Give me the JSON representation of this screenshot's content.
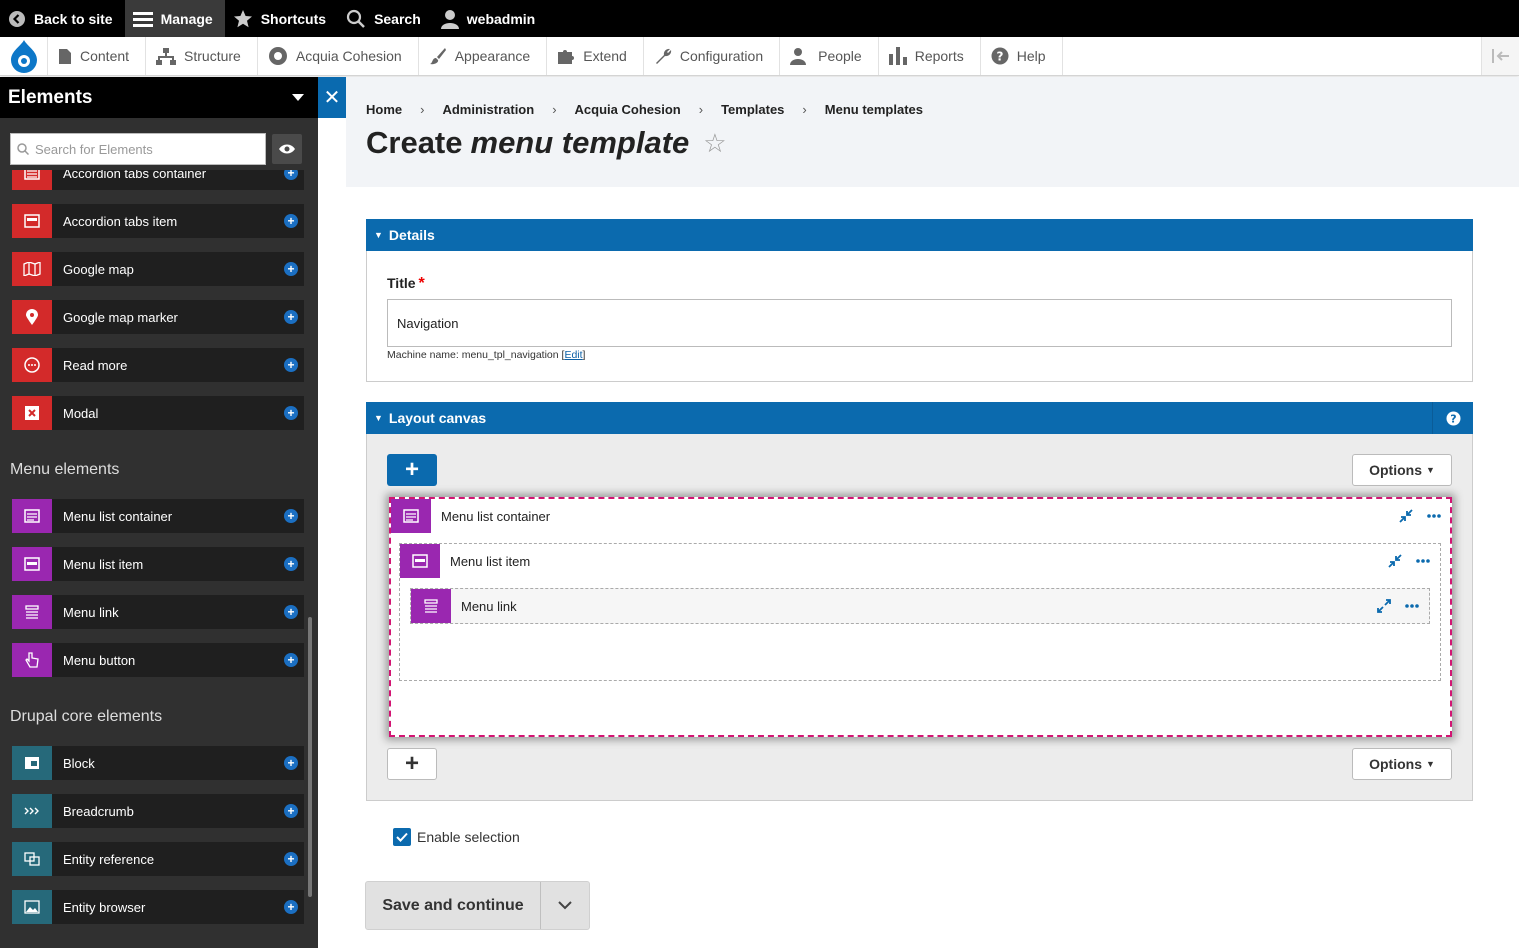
{
  "topbar": {
    "back": "Back to site",
    "manage": "Manage",
    "shortcuts": "Shortcuts",
    "search": "Search",
    "user": "webadmin"
  },
  "tray": {
    "items": [
      "Content",
      "Structure",
      "Acquia Cohesion",
      "Appearance",
      "Extend",
      "Configuration",
      "People",
      "Reports",
      "Help"
    ]
  },
  "sidebar": {
    "title": "Elements",
    "search_placeholder": "Search for Elements",
    "items_general": [
      {
        "label": "Accordion tabs container",
        "color": "#d32a2a"
      },
      {
        "label": "Accordion tabs item",
        "color": "#d32a2a"
      },
      {
        "label": "Google map",
        "color": "#d32a2a"
      },
      {
        "label": "Google map marker",
        "color": "#d32a2a"
      },
      {
        "label": "Read more",
        "color": "#d32a2a"
      },
      {
        "label": "Modal",
        "color": "#d32a2a"
      }
    ],
    "cat_menu": "Menu elements",
    "items_menu": [
      {
        "label": "Menu list container",
        "color": "#9a27b0"
      },
      {
        "label": "Menu list item",
        "color": "#9a27b0"
      },
      {
        "label": "Menu link",
        "color": "#9a27b0"
      },
      {
        "label": "Menu button",
        "color": "#9a27b0"
      }
    ],
    "cat_core": "Drupal core elements",
    "items_core": [
      {
        "label": "Block",
        "color": "#26697a"
      },
      {
        "label": "Breadcrumb",
        "color": "#26697a"
      },
      {
        "label": "Entity reference",
        "color": "#26697a"
      },
      {
        "label": "Entity browser",
        "color": "#26697a"
      }
    ]
  },
  "header": {
    "breadcrumb": [
      "Home",
      "Administration",
      "Acquia Cohesion",
      "Templates",
      "Menu templates"
    ],
    "title_plain": "Create",
    "title_em": "menu template"
  },
  "details": {
    "heading": "Details",
    "title_label": "Title",
    "title_value": "Navigation",
    "machine_text": "Machine name: menu_tpl_navigation",
    "edit_link": "Edit"
  },
  "canvas": {
    "heading": "Layout canvas",
    "options_label": "Options",
    "add_label": "+",
    "container": "Menu list container",
    "item": "Menu list item",
    "link": "Menu link"
  },
  "form": {
    "enable_selection": "Enable selection",
    "save_label": "Save and continue"
  },
  "colors": {
    "accent": "#0b6aae",
    "menu_purple": "#9a27b0",
    "general_red": "#d32a2a",
    "core_teal": "#26697a",
    "selection_border": "#d21473"
  }
}
